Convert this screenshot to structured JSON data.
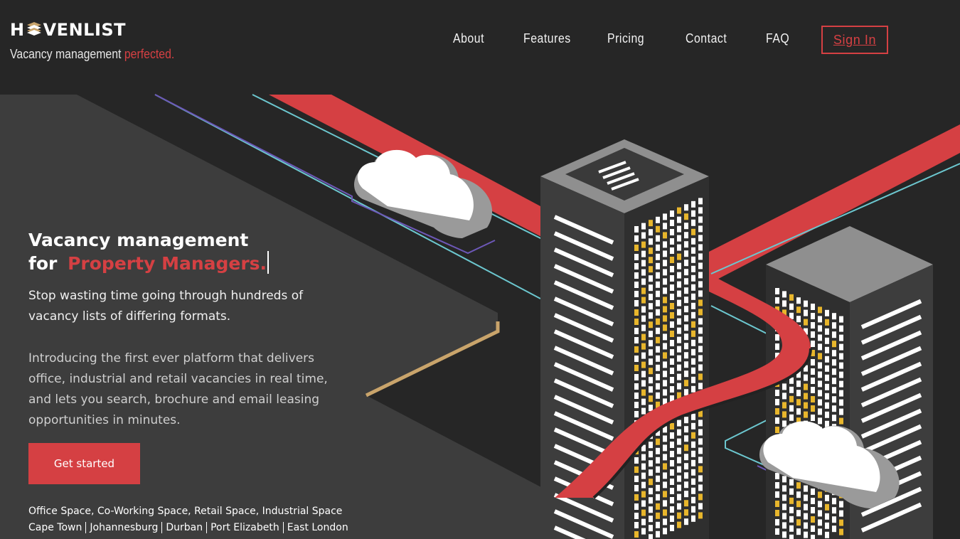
{
  "brand": {
    "name_start": "H",
    "name_end": "VENLIST",
    "tagline": "Vacancy management",
    "tagline_accent": "perfected."
  },
  "nav": {
    "items": [
      "About",
      "Features",
      "Pricing",
      "Contact",
      "FAQ"
    ],
    "signin": "Sign In"
  },
  "hero": {
    "title_line1": "Vacancy management",
    "title_for": "for",
    "title_accent": "Property Managers.",
    "paragraph1": "Stop wasting time going through hundreds of vacancy lists of differing formats.",
    "paragraph2": "Introducing the first ever platform that delivers office, industrial and retail vacancies in real time, and lets you search, brochure and email leasing opportunities in minutes.",
    "cta": "Get started",
    "spaces": "Office Space, Co-Working Space, Retail Space, Industrial Space",
    "cities": [
      "Cape Town",
      "Johannesburg",
      "Durban",
      "Port Elizabeth",
      "East London"
    ]
  },
  "colors": {
    "background": "#262626",
    "panel": "#3d3d3d",
    "accent": "#d54043",
    "window_yellow": "#e8b62c",
    "line_cyan": "#6cc7cf",
    "line_purple": "#6d58b8",
    "panel_edge": "#c9a46b"
  },
  "icons": {
    "logo_mark": "stacked-books-icon",
    "clouds": "cloud-icon",
    "buildings": "skyscraper-icon"
  }
}
